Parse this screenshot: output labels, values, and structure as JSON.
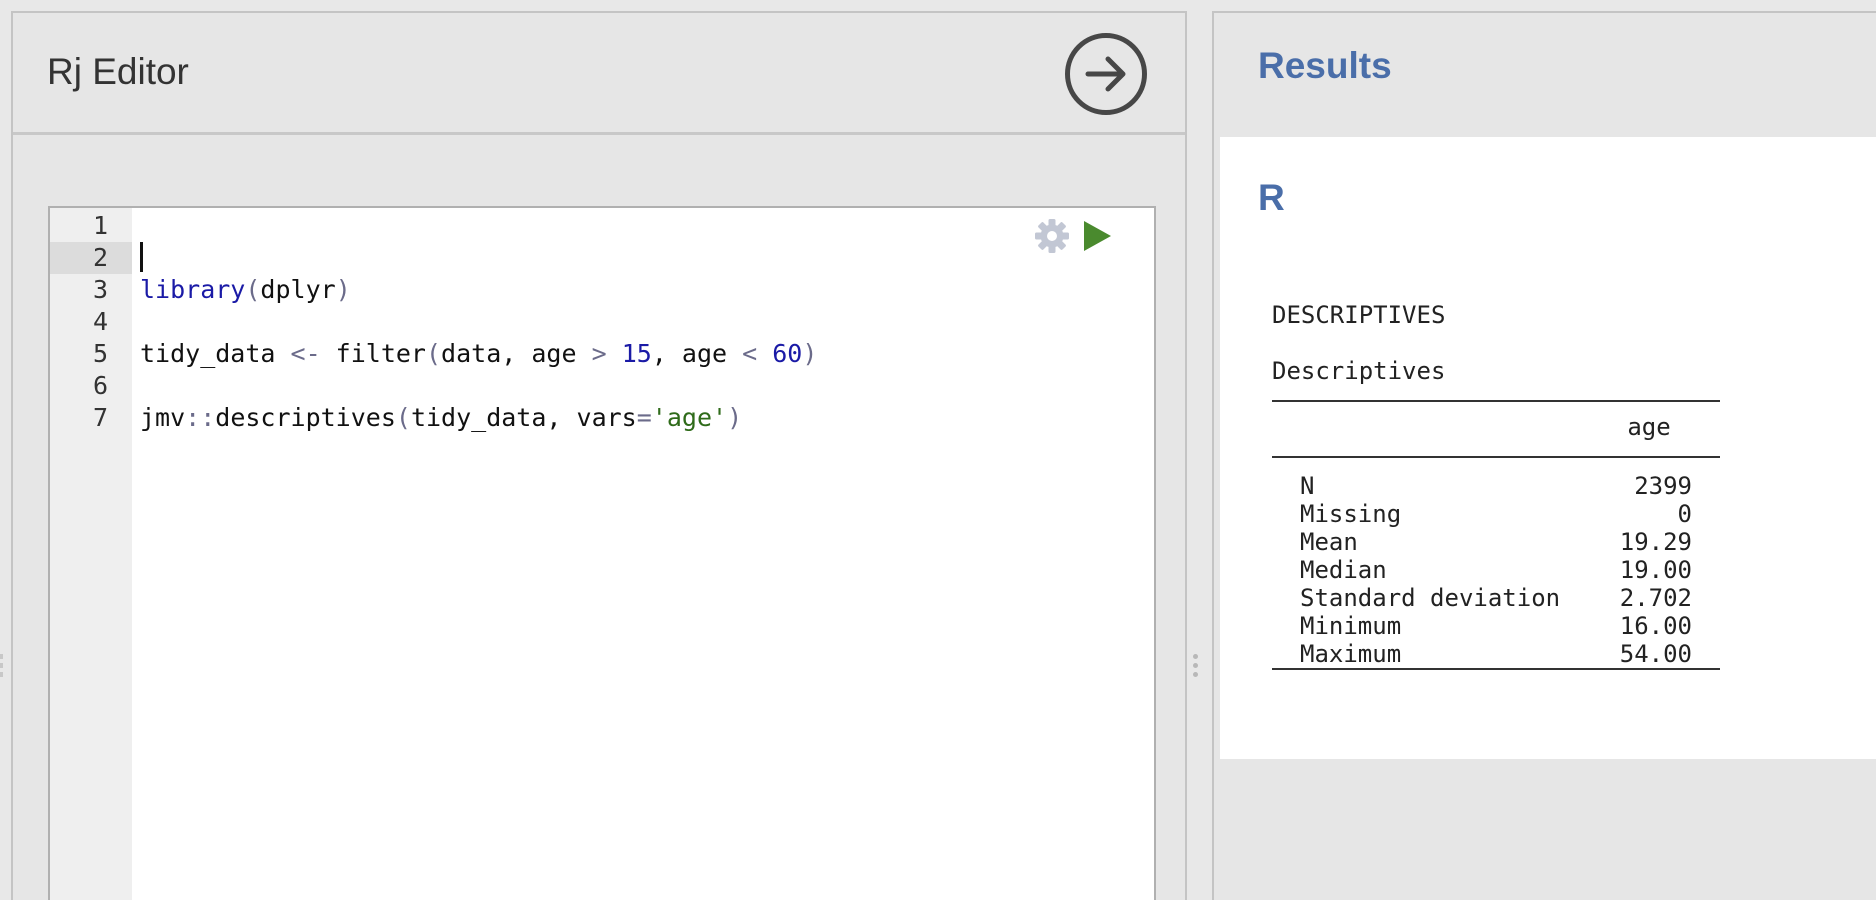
{
  "editor": {
    "title": "Rj Editor",
    "code_lines": [
      {
        "num": "1",
        "tokens": []
      },
      {
        "num": "2",
        "tokens": []
      },
      {
        "num": "3",
        "tokens": [
          {
            "t": "library",
            "c": "kw"
          },
          {
            "t": "(",
            "c": "op"
          },
          {
            "t": "dplyr",
            "c": "plain"
          },
          {
            "t": ")",
            "c": "op"
          }
        ]
      },
      {
        "num": "4",
        "tokens": []
      },
      {
        "num": "5",
        "tokens": [
          {
            "t": "tidy_data ",
            "c": "plain"
          },
          {
            "t": "<-",
            "c": "op"
          },
          {
            "t": " filter",
            "c": "plain"
          },
          {
            "t": "(",
            "c": "op"
          },
          {
            "t": "data, age ",
            "c": "plain"
          },
          {
            "t": ">",
            "c": "op"
          },
          {
            "t": " ",
            "c": "plain"
          },
          {
            "t": "15",
            "c": "num"
          },
          {
            "t": ", age ",
            "c": "plain"
          },
          {
            "t": "<",
            "c": "op"
          },
          {
            "t": " ",
            "c": "plain"
          },
          {
            "t": "60",
            "c": "num"
          },
          {
            "t": ")",
            "c": "op"
          }
        ]
      },
      {
        "num": "6",
        "tokens": []
      },
      {
        "num": "7",
        "tokens": [
          {
            "t": "jmv",
            "c": "plain"
          },
          {
            "t": "::",
            "c": "op"
          },
          {
            "t": "descriptives",
            "c": "plain"
          },
          {
            "t": "(",
            "c": "op"
          },
          {
            "t": "tidy_data, vars",
            "c": "plain"
          },
          {
            "t": "=",
            "c": "op"
          },
          {
            "t": "'age'",
            "c": "str"
          },
          {
            "t": ")",
            "c": "op"
          }
        ]
      }
    ],
    "active_line": "2",
    "icons": {
      "run_arrow": "arrow-right-circle-icon",
      "gear": "gear-icon",
      "play": "play-icon"
    }
  },
  "results": {
    "title": "Results",
    "section_heading": "R",
    "analysis_title": "DESCRIPTIVES",
    "table_title": "Descriptives",
    "column_header": "age",
    "rows": [
      {
        "label": "N",
        "value": "2399"
      },
      {
        "label": "Missing",
        "value": "0"
      },
      {
        "label": "Mean",
        "value": "19.29"
      },
      {
        "label": "Median",
        "value": "19.00"
      },
      {
        "label": "Standard deviation",
        "value": "2.702"
      },
      {
        "label": "Minimum",
        "value": "16.00"
      },
      {
        "label": "Maximum",
        "value": "54.00"
      }
    ]
  },
  "colors": {
    "accent_blue": "#4a6ea9",
    "play_green": "#4a8a2e",
    "keyword_blue": "#1a1aa6",
    "string_green": "#2f6b1a"
  }
}
